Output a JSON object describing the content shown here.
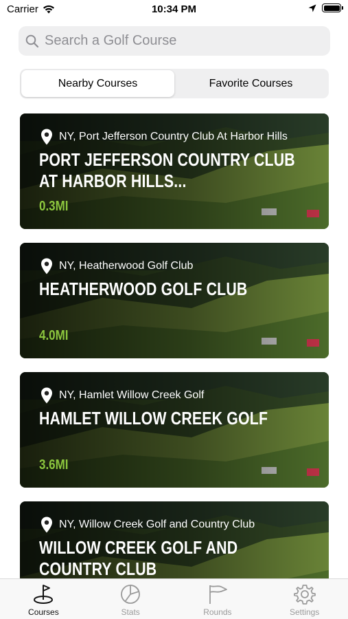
{
  "status_bar": {
    "carrier": "Carrier",
    "time": "10:34 PM"
  },
  "search": {
    "placeholder": "Search a Golf Course"
  },
  "segments": [
    {
      "label": "Nearby Courses",
      "active": true
    },
    {
      "label": "Favorite Courses",
      "active": false
    }
  ],
  "courses": [
    {
      "location": "NY, Port Jefferson Country Club At Harbor Hills",
      "title": "PORT JEFFERSON COUNTRY CLUB AT HARBOR HILLS...",
      "distance": "0.3MI"
    },
    {
      "location": "NY, Heatherwood Golf Club",
      "title": "HEATHERWOOD GOLF CLUB",
      "distance": "4.0MI"
    },
    {
      "location": "NY, Hamlet Willow Creek Golf",
      "title": "HAMLET WILLOW CREEK GOLF",
      "distance": "3.6MI"
    },
    {
      "location": "NY, Willow Creek Golf and Country Club",
      "title": "WILLOW CREEK GOLF AND COUNTRY CLUB",
      "distance": ""
    }
  ],
  "tabs": [
    {
      "label": "Courses",
      "icon": "golf-flag-hole-icon",
      "active": true
    },
    {
      "label": "Stats",
      "icon": "pie-chart-icon",
      "active": false
    },
    {
      "label": "Rounds",
      "icon": "flag-icon",
      "active": false
    },
    {
      "label": "Settings",
      "icon": "gear-icon",
      "active": false
    }
  ],
  "colors": {
    "accent_green": "#8cc63e",
    "search_bg": "#efeff0",
    "inactive_tab": "#9a9a9a"
  }
}
